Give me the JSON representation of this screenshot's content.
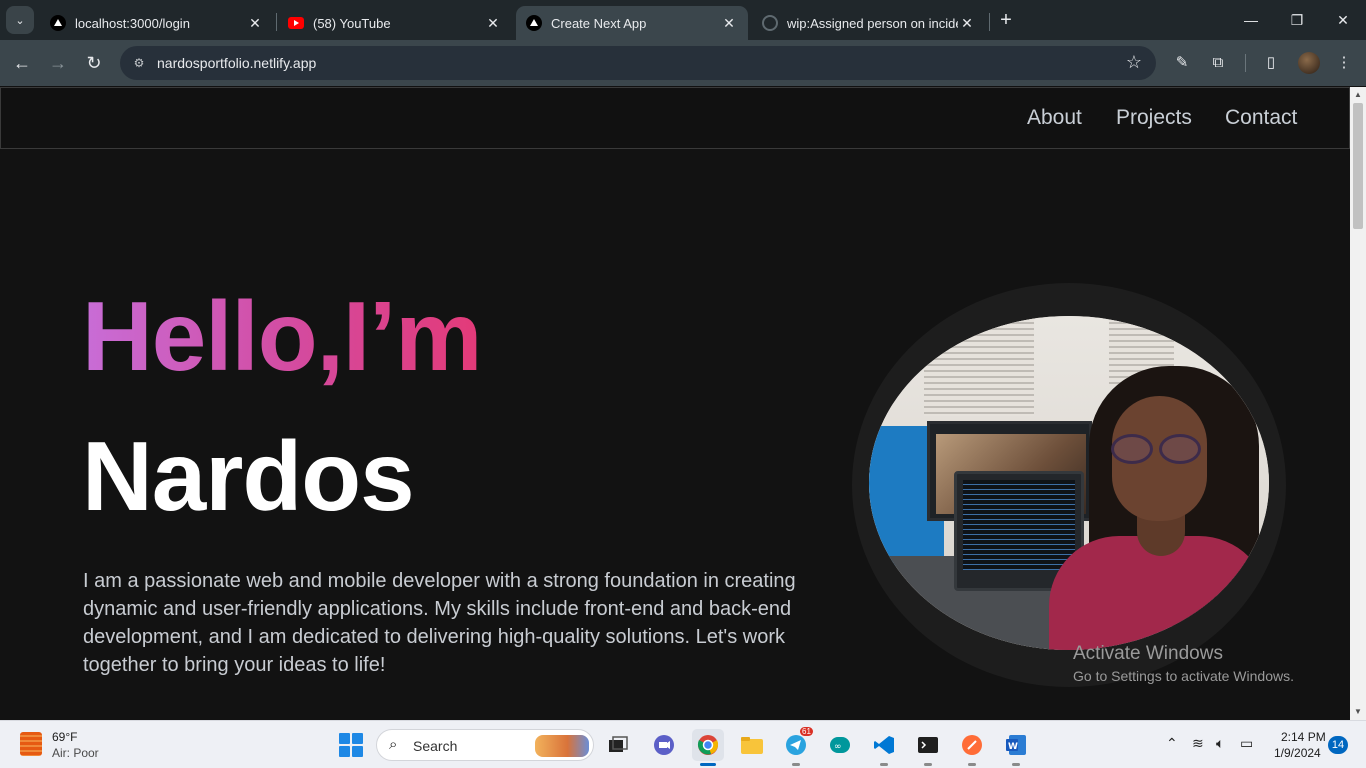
{
  "browser": {
    "tabs": [
      {
        "title": "localhost:3000/login",
        "favicon": "nextjs-triangle-icon"
      },
      {
        "title": "(58) YouTube",
        "favicon": "youtube-icon"
      },
      {
        "title": "Create Next App",
        "favicon": "nextjs-triangle-icon",
        "active": true
      },
      {
        "title": "wip:Assigned person on inciden",
        "favicon": "github-icon"
      }
    ],
    "url": "nardosportfolio.netlify.app"
  },
  "site": {
    "nav": {
      "about": "About",
      "projects": "Projects",
      "contact": "Contact"
    },
    "hero": {
      "greeting": "Hello,I’m",
      "name": "Nardos",
      "bio": "I am a passionate web and mobile developer with a strong foundation in creating dynamic and user-friendly applications. My skills include front-end and back-end development, and I am dedicated to delivering high-quality solutions. Let's work together to bring your ideas to life!"
    },
    "colors": {
      "background": "#121212",
      "gradient_start": "#c86dd7",
      "gradient_end": "#e33a78"
    }
  },
  "watermark": {
    "title": "Activate Windows",
    "subtitle": "Go to Settings to activate Windows."
  },
  "taskbar": {
    "weather": {
      "temp": "69°F",
      "air": "Air: Poor"
    },
    "search_label": "Search",
    "telegram_badge": "61",
    "clock": {
      "time": "2:14 PM",
      "date": "1/9/2024"
    },
    "notifications": "14"
  }
}
